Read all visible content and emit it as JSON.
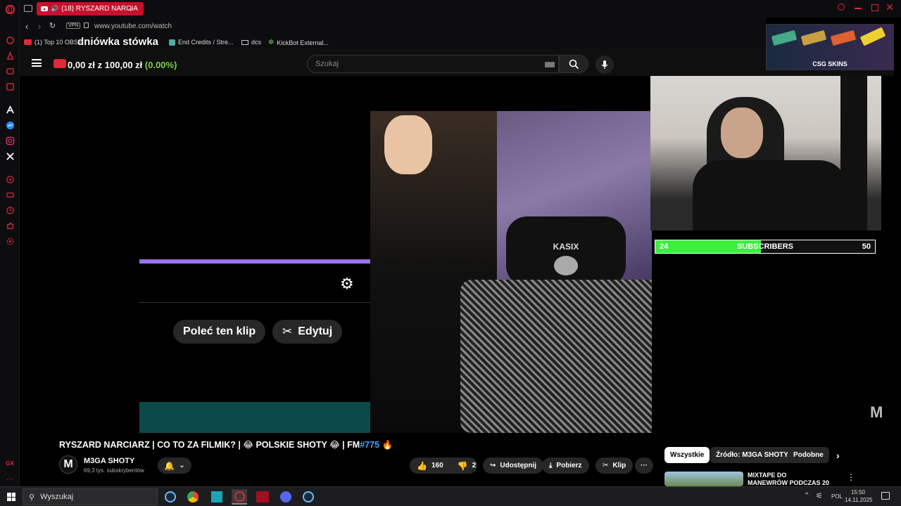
{
  "browser": {
    "tab_title": "(18) RYSZARD NARCIA",
    "url": "www.youtube.com/watch",
    "vpn_badge": "VPN",
    "bookmarks": [
      {
        "label": "(1) Top 10 OBS P"
      },
      {
        "label": "End Credits / Stre..."
      },
      {
        "label": "dcs"
      },
      {
        "label": "KickBot External..."
      }
    ]
  },
  "overlay": {
    "donation_title": "dniówka stówka",
    "donation_current": "0,00 zł",
    "donation_sep": "z",
    "donation_goal": "100,00 zł",
    "donation_percent": "(0.00%)",
    "donation_percent_color": "#7bd84a"
  },
  "youtube": {
    "search_placeholder": "Szukaj",
    "video": {
      "clip_buttons": [
        {
          "label": "Poleć ten klip"
        },
        {
          "label": "Edytuj"
        }
      ],
      "chair_brand": "KASIX",
      "sub_goal": {
        "current": "24",
        "label": "SUBSCRIBERS",
        "goal": "50",
        "progress": 0.48,
        "color": "#3cf03c"
      },
      "sponsor": "CSG SKINS",
      "watermark": "M"
    },
    "title": "RYSZARD NARCIARZ | CO TO ZA FILMIK? | 😂 POLSKIE SHOTY 😂 | FM",
    "title_hashtag": "#775",
    "title_emoji_end": "🔥",
    "channel": {
      "name": "M3GA SHOTY",
      "subscribers": "69,3 tys. subskrybentów"
    },
    "actions": {
      "likes": "160",
      "dislikes": "2",
      "share": "Udostępnij",
      "download": "Pobierz",
      "clip": "Klip"
    },
    "filter_chips": [
      {
        "label": "Wszystkie",
        "active": true
      },
      {
        "label": "Źródło: M3GA SHOTY",
        "active": false
      },
      {
        "label": "Podobne",
        "active": false
      }
    ],
    "recommended": {
      "thumb_title_line1": "MIXTAPE DO",
      "thumb_title_line2": "MANEWRÓW PODCZAS 20"
    }
  },
  "taskbar": {
    "search_placeholder": "Wyszukaj",
    "language": "POL",
    "time": "15:50",
    "date": "14.11.2025"
  }
}
